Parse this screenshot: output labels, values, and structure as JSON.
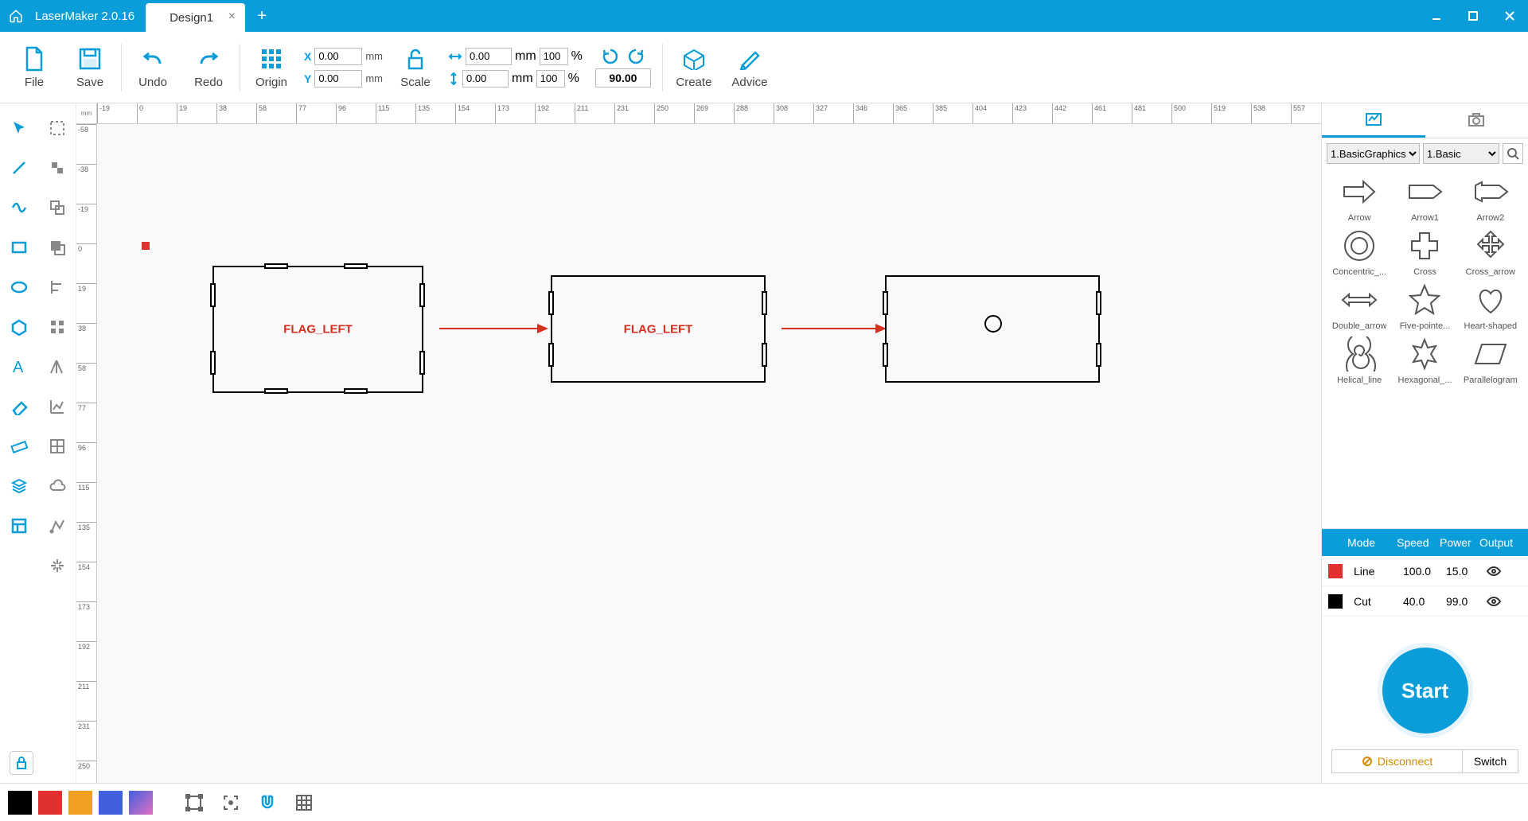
{
  "app": {
    "title": "LaserMaker 2.0.16"
  },
  "tabs": {
    "active": "Design1"
  },
  "toolbar": {
    "file": "File",
    "save": "Save",
    "undo": "Undo",
    "redo": "Redo",
    "origin": "Origin",
    "scale": "Scale",
    "create": "Create",
    "advice": "Advice"
  },
  "coords": {
    "x_label": "X",
    "x_val": "0.00",
    "y_label": "Y",
    "y_val": "0.00",
    "unit": "mm"
  },
  "dims": {
    "w_val": "0.00",
    "h_val": "0.00",
    "unit": "mm",
    "w_pct": "100",
    "h_pct": "100",
    "pct": "%"
  },
  "rotate": {
    "angle": "90.00"
  },
  "ruler_unit": "mm",
  "ruler_h": [
    "-19",
    "0",
    "19",
    "38",
    "58",
    "77",
    "96",
    "115",
    "135",
    "154",
    "173",
    "192",
    "211",
    "231",
    "250",
    "269",
    "288",
    "308",
    "327",
    "346",
    "365",
    "385",
    "404",
    "423",
    "442",
    "461",
    "481",
    "500",
    "519",
    "538",
    "557"
  ],
  "ruler_v": [
    "-58",
    "-38",
    "-19",
    "0",
    "19",
    "38",
    "58",
    "77",
    "96",
    "115",
    "135",
    "154",
    "173",
    "192",
    "211",
    "231",
    "250"
  ],
  "canvas": {
    "box1_label": "FLAG_LEFT",
    "box2_label": "FLAG_LEFT"
  },
  "right": {
    "cat1": "1.BasicGraphics",
    "cat2": "1.Basic"
  },
  "shapes": [
    {
      "k": "arrow",
      "l": "Arrow"
    },
    {
      "k": "arrow1",
      "l": "Arrow1"
    },
    {
      "k": "arrow2",
      "l": "Arrow2"
    },
    {
      "k": "concentric",
      "l": "Concentric_..."
    },
    {
      "k": "cross",
      "l": "Cross"
    },
    {
      "k": "crossarr",
      "l": "Cross_arrow"
    },
    {
      "k": "dblarrow",
      "l": "Double_arrow"
    },
    {
      "k": "star",
      "l": "Five-pointe..."
    },
    {
      "k": "heart",
      "l": "Heart-shaped"
    },
    {
      "k": "helical",
      "l": "Helical_line"
    },
    {
      "k": "hexstar",
      "l": "Hexagonal_..."
    },
    {
      "k": "para",
      "l": "Parallelogram"
    }
  ],
  "layers": {
    "head": {
      "mode": "Mode",
      "speed": "Speed",
      "power": "Power",
      "output": "Output"
    },
    "rows": [
      {
        "color": "#e03030",
        "mode": "Line",
        "speed": "100.0",
        "power": "15.0"
      },
      {
        "color": "#000000",
        "mode": "Cut",
        "speed": "40.0",
        "power": "99.0"
      }
    ]
  },
  "start": {
    "label": "Start"
  },
  "conn": {
    "disconnect": "Disconnect",
    "switch": "Switch"
  },
  "palette": [
    "#000000",
    "#e03030",
    "#f0a020",
    "#4060e0",
    "#e070c0"
  ]
}
